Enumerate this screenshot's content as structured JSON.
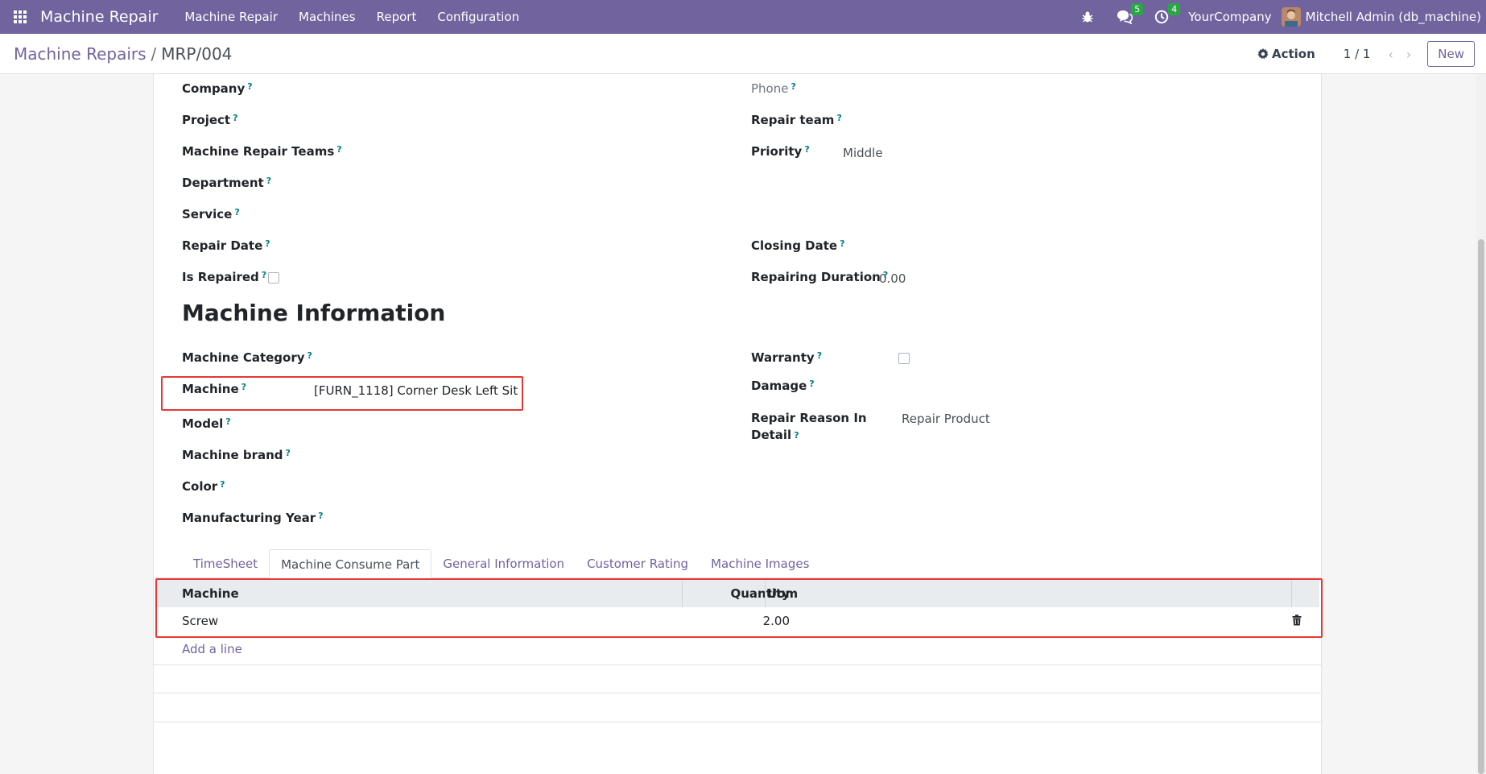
{
  "topbar": {
    "app_title": "Machine Repair",
    "nav": [
      "Machine Repair",
      "Machines",
      "Report",
      "Configuration"
    ],
    "messages_badge": "5",
    "activities_badge": "4",
    "company": "YourCompany",
    "user": "Mitchell Admin (db_machine)"
  },
  "control": {
    "breadcrumb_parent": "Machine Repairs",
    "breadcrumb_sep": "/",
    "breadcrumb_current": "MRP/004",
    "action_label": "Action",
    "pager": "1 / 1",
    "new_label": "New"
  },
  "form": {
    "left": {
      "company": "Company",
      "project": "Project",
      "teams": "Machine Repair Teams",
      "department": "Department",
      "service": "Service",
      "repair_date": "Repair Date",
      "is_repaired": "Is Repaired"
    },
    "right": {
      "phone": "Phone",
      "repair_team": "Repair team",
      "priority": "Priority",
      "priority_value": "Middle",
      "closing_date": "Closing Date",
      "duration": "Repairing Duration",
      "duration_value": "0.00"
    },
    "machine_info": {
      "title": "Machine Information",
      "category": "Machine Category",
      "machine": "Machine",
      "machine_value": "[FURN_1118] Corner Desk Left Sit",
      "model": "Model",
      "brand": "Machine brand",
      "color": "Color",
      "year": "Manufacturing Year",
      "warranty": "Warranty",
      "damage": "Damage",
      "reason_line1": "Repair Reason In",
      "reason_line2": "Detail",
      "reason_value": "Repair Product"
    },
    "help_mark": "?"
  },
  "tabs": [
    "TimeSheet",
    "Machine Consume Part",
    "General Information",
    "Customer Rating",
    "Machine Images"
  ],
  "table": {
    "headers": [
      "Machine",
      "Quantity",
      "Uom"
    ],
    "rows": [
      {
        "machine": "Screw",
        "quantity": "2.00",
        "uom": ""
      }
    ],
    "add_line": "Add a line"
  },
  "colors": {
    "brand": "#71639e",
    "highlight": "#e53935",
    "help": "#017e84",
    "badge": "#28a745"
  }
}
